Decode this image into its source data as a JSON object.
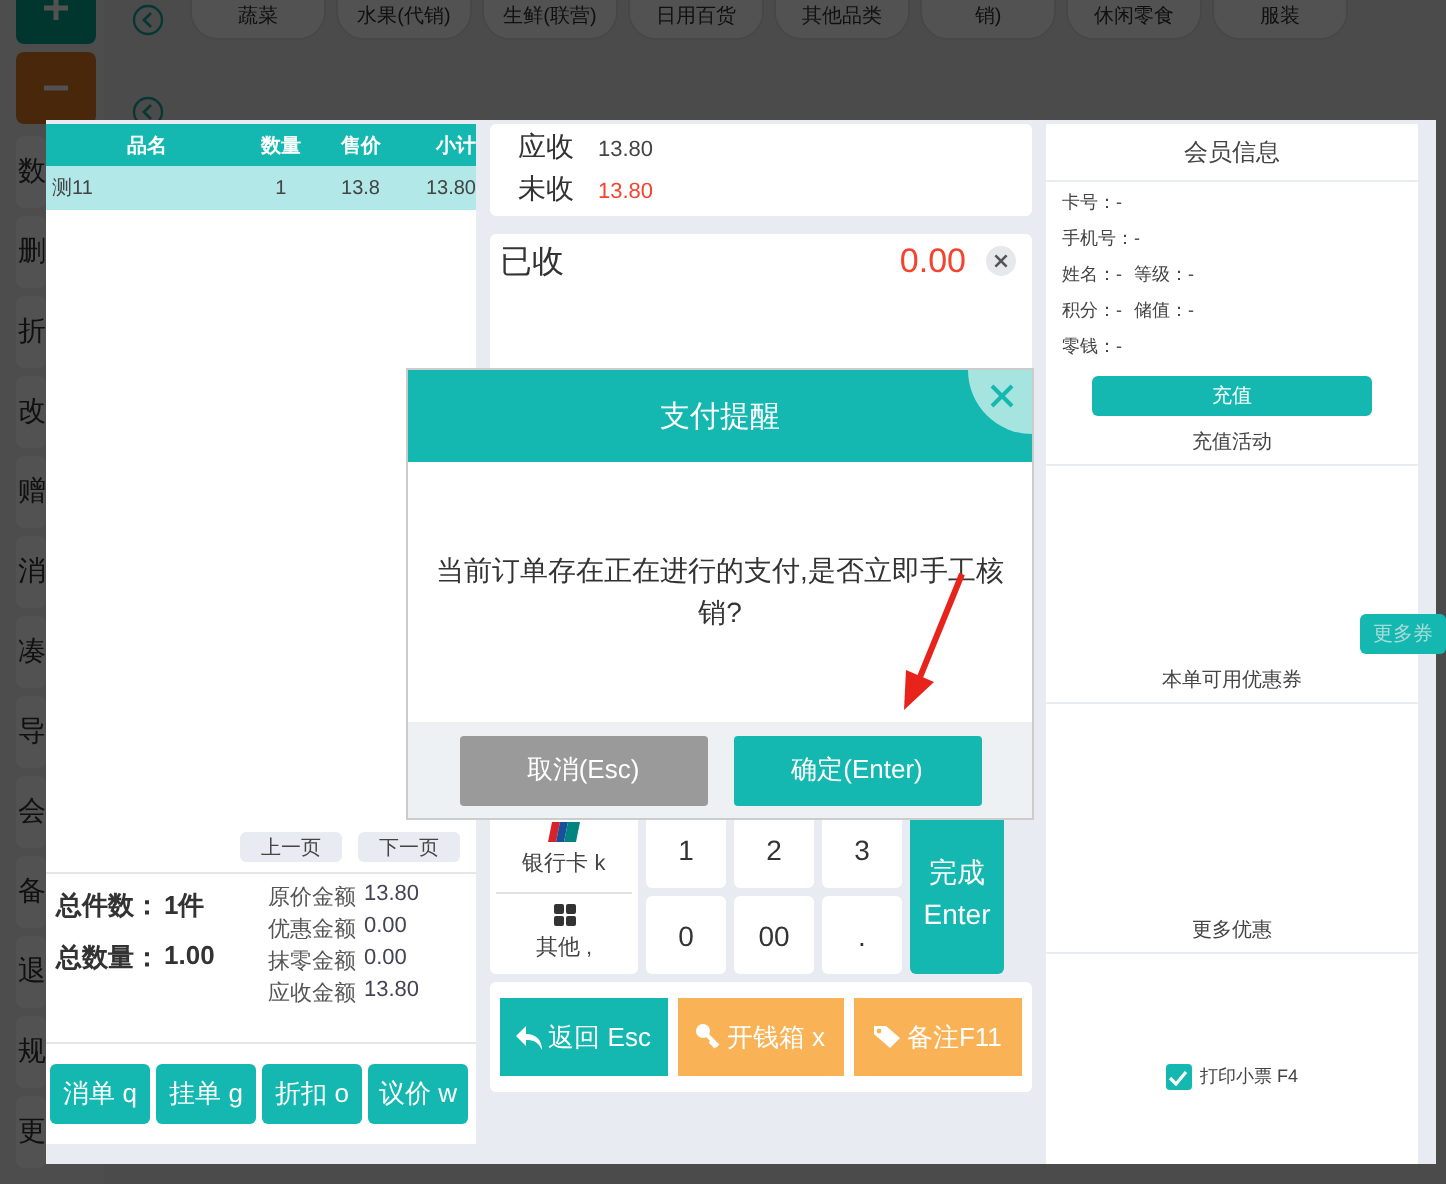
{
  "background": {
    "rail_buttons": [
      {
        "kind": "add"
      },
      {
        "kind": "remove"
      }
    ],
    "categories": [
      "蔬菜",
      "水果(代销)",
      "生鲜(联营)",
      "日用百货",
      "其他品类",
      "销)",
      "休闲零食",
      "服装"
    ],
    "sidebar": [
      "数",
      "删",
      "折",
      "改",
      "赠",
      "消",
      "凑",
      "导",
      "会",
      "备",
      "退",
      "规",
      "更"
    ]
  },
  "order_table": {
    "columns": [
      "品名",
      "数量",
      "售价",
      "小计"
    ],
    "rows": [
      {
        "cells": [
          "测11",
          "1",
          "13.8",
          "13.80"
        ],
        "selected": true
      }
    ]
  },
  "pager": [
    "上一页",
    "下一页"
  ],
  "totals": [
    {
      "label": "总件数：",
      "value": "1件"
    },
    {
      "label": "总数量：",
      "value": "1.00"
    }
  ],
  "amounts": [
    {
      "label": "原价金额",
      "value": "13.80"
    },
    {
      "label": "优惠金额",
      "value": "0.00"
    },
    {
      "label": "抹零金额",
      "value": "0.00"
    },
    {
      "label": "应收金额",
      "value": "13.80"
    }
  ],
  "order_actions": [
    "消单 q",
    "挂单 g",
    "折扣 o",
    "议价 w"
  ],
  "due": [
    {
      "label": "应收",
      "value": "13.80",
      "kind": "normal"
    },
    {
      "label": "未收",
      "value": "13.80",
      "kind": "alert"
    }
  ],
  "received": {
    "label": "已收",
    "value": "0.00"
  },
  "payment_methods": [
    {
      "label": "银行卡 k",
      "kind": "card"
    },
    {
      "label": "其他 ,",
      "kind": "other"
    }
  ],
  "keypad": [
    "1",
    "2",
    "3",
    "0",
    "00",
    "."
  ],
  "finish_button": [
    "完成",
    "Enter"
  ],
  "footer_actions": [
    {
      "label": "返回 Esc",
      "kind": "back"
    },
    {
      "label": "开钱箱 x",
      "kind": "drawer"
    },
    {
      "label": "备注F11",
      "kind": "note"
    }
  ],
  "member": {
    "title": "会员信息",
    "rows": [
      [
        {
          "label": "卡号：",
          "value": "-"
        }
      ],
      [
        {
          "label": "手机号：",
          "value": "-"
        }
      ],
      [
        {
          "label": "姓名：",
          "value": "-"
        },
        {
          "label": "等级：",
          "value": "-"
        }
      ],
      [
        {
          "label": "积分：",
          "value": "-"
        },
        {
          "label": "储值：",
          "value": "-"
        }
      ],
      [
        {
          "label": "零钱：",
          "value": "-"
        }
      ]
    ],
    "recharge_button": "充值"
  },
  "recharge_activity": "充值活动",
  "more_coupons_button": "更多券",
  "coupons_title": "本单可用优惠券",
  "more_offers_title": "更多优惠",
  "print_receipt": {
    "label": "打印小票 F4",
    "checked": true
  },
  "dialog": {
    "title": "支付提醒",
    "message": "当前订单存在正在进行的支付,是否立即手工核销?",
    "buttons": [
      {
        "label": "取消(Esc)",
        "kind": "cancel"
      },
      {
        "label": "确定(Enter)",
        "kind": "confirm"
      }
    ]
  }
}
